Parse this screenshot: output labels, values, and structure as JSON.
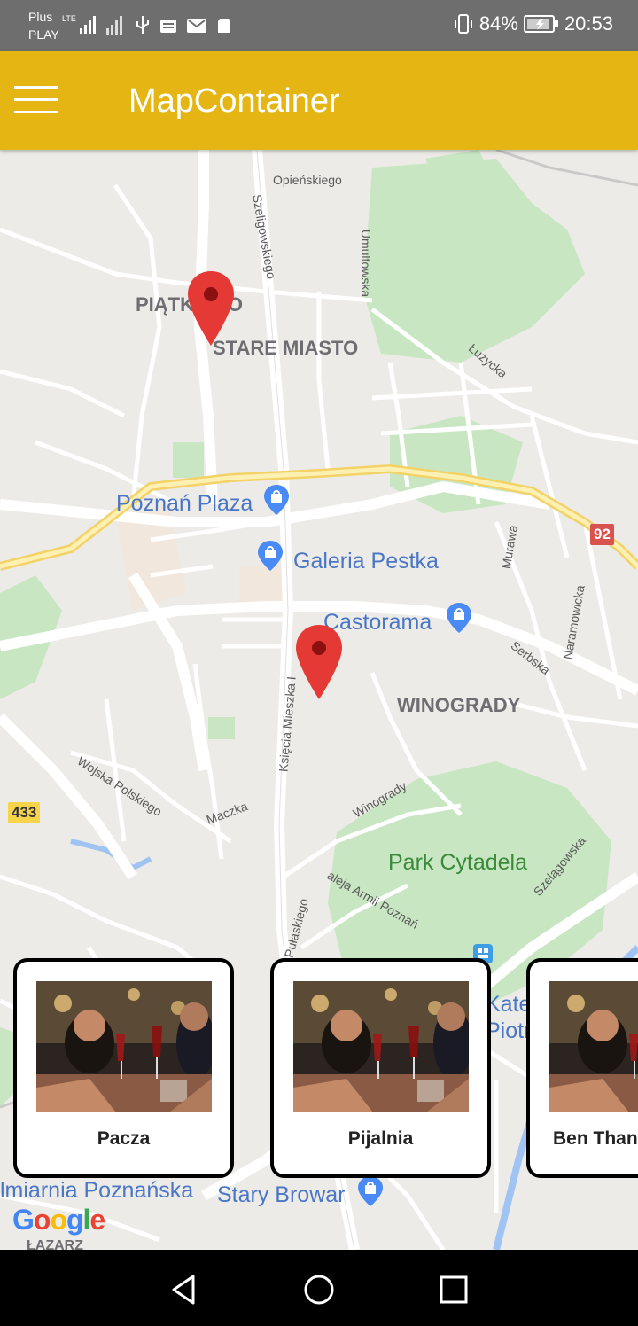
{
  "status_bar": {
    "carrier_line1": "Plus",
    "carrier_line2": "PLAY",
    "network": "LTE",
    "battery": "84%",
    "time": "20:53"
  },
  "app_bar": {
    "title": "MapContainer"
  },
  "map": {
    "districts": [
      "PIĄTKOWO",
      "STARE MIASTO",
      "WINOGRADY"
    ],
    "streets": [
      "Opieńskiego",
      "Szeligowskiego",
      "Umultowska",
      "Łużycka",
      "Murawa",
      "Naramowicka",
      "Serbska",
      "Księcia Mieszka I",
      "Wojska Polskiego",
      "Maczka",
      "Winogrady",
      "aleja Armii Poznań",
      "Pułaskiego",
      "Szelągowska"
    ],
    "pois": [
      "Poznań Plaza",
      "Galeria Pestka",
      "Castorama",
      "Stary Browar",
      "lmiarnia Poznańska",
      "Katedra",
      "Piotr"
    ],
    "park": "Park Cytadela",
    "routes": [
      "92",
      "433"
    ],
    "provider": "Google",
    "cut_text": "ŁAZARZ"
  },
  "cards": [
    {
      "name": "Pacza"
    },
    {
      "name": "Pijalnia"
    },
    {
      "name": "Ben Than"
    }
  ],
  "colors": {
    "app_bar": "#e5b513",
    "marker": "#e53935",
    "status_bar": "#6e6e6e"
  }
}
